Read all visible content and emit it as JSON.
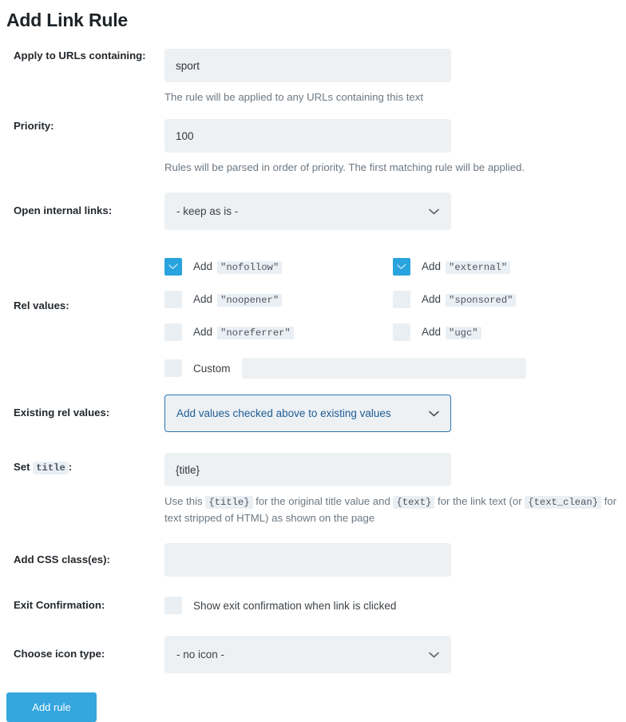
{
  "page": {
    "title": "Add Link Rule"
  },
  "fields": {
    "url_contains": {
      "label": "Apply to URLs containing:",
      "value": "sport",
      "placeholder": "",
      "help": "The rule will be applied to any URLs containing this text"
    },
    "priority": {
      "label": "Priority:",
      "value": "100",
      "placeholder": "",
      "help": "Rules will be parsed in order of priority. The first matching rule will be applied."
    },
    "open_internal_links": {
      "label": "Open internal links:",
      "value": "- keep as is -",
      "caret": "chevron-down-icon"
    },
    "rel_values": {
      "label": "Rel values:",
      "items": [
        {
          "name": "nofollow",
          "prefix": "Add",
          "code": "\"nofollow\"",
          "checked": true
        },
        {
          "name": "external",
          "prefix": "Add",
          "code": "\"external\"",
          "checked": true
        },
        {
          "name": "noopener",
          "prefix": "Add",
          "code": "\"noopener\"",
          "checked": false
        },
        {
          "name": "sponsored",
          "prefix": "Add",
          "code": "\"sponsored\"",
          "checked": false
        },
        {
          "name": "noreferrer",
          "prefix": "Add",
          "code": "\"noreferrer\"",
          "checked": false
        },
        {
          "name": "ugc",
          "prefix": "Add",
          "code": "\"ugc\"",
          "checked": false
        }
      ],
      "custom": {
        "label": "Custom",
        "checked": false,
        "value": "",
        "placeholder": ""
      }
    },
    "existing_rel_values": {
      "label": "Existing rel values:",
      "value": "Add values checked above to existing values",
      "caret": "chevron-down-icon",
      "focused": true
    },
    "set_title": {
      "label_prefix": "Set",
      "label_code": "title",
      "label_suffix": ":",
      "value": "{title}",
      "placeholder": "",
      "help_1": "Use this",
      "help_code_1": "{title}",
      "help_2": "for the original title value and",
      "help_code_2": "{text}",
      "help_3": "for the link text (or",
      "help_code_3": "{text_clean}",
      "help_4": "for text stripped of HTML) as shown on the page"
    },
    "css_classes": {
      "label": "Add CSS class(es):",
      "value": "",
      "placeholder": ""
    },
    "exit_confirmation": {
      "label": "Exit Confirmation:",
      "checkbox_label": "Show exit confirmation when link is clicked",
      "checked": false
    },
    "icon_type": {
      "label": "Choose icon type:",
      "value": "- no icon -",
      "caret": "chevron-down-icon"
    }
  },
  "actions": {
    "submit_label": "Add rule"
  },
  "colors": {
    "accent": "#35a6de",
    "checkbox_on": "#29a3dd",
    "field_bg": "#edf1f4",
    "focus_border": "#2d76b4",
    "focus_text": "#1f5c94",
    "label": "#23282d",
    "help_text": "#6d7882"
  }
}
